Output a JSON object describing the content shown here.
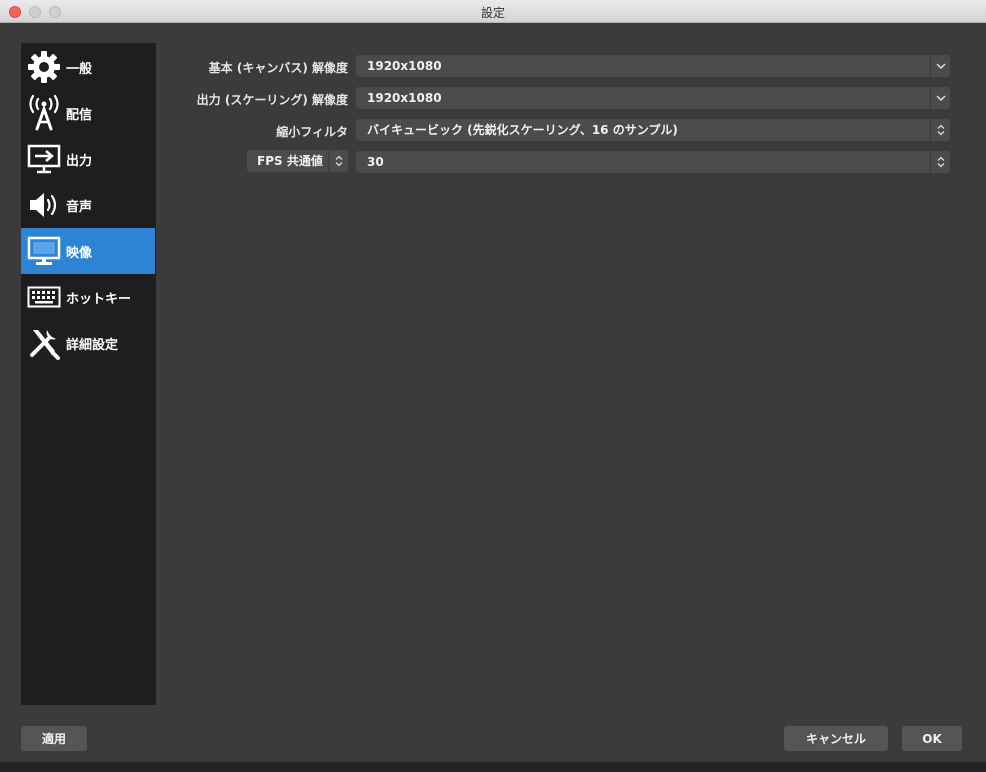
{
  "window": {
    "title": "設定"
  },
  "sidebar": {
    "items": [
      {
        "label": "一般",
        "icon": "gear-icon"
      },
      {
        "label": "配信",
        "icon": "broadcast-antenna-icon"
      },
      {
        "label": "出力",
        "icon": "output-monitor-icon"
      },
      {
        "label": "音声",
        "icon": "speaker-icon"
      },
      {
        "label": "映像",
        "icon": "monitor-icon",
        "active": true
      },
      {
        "label": "ホットキー",
        "icon": "keyboard-icon"
      },
      {
        "label": "詳細設定",
        "icon": "tools-icon"
      }
    ]
  },
  "video": {
    "base_resolution": {
      "label": "基本 (キャンバス) 解像度",
      "value": "1920x1080"
    },
    "output_resolution": {
      "label": "出力 (スケーリング) 解像度",
      "value": "1920x1080"
    },
    "downscale_filter": {
      "label": "縮小フィルタ",
      "value": "バイキュービック (先鋭化スケーリング、16 のサンプル)"
    },
    "fps": {
      "type_label": "FPS 共通値",
      "value": "30"
    }
  },
  "buttons": {
    "apply": "適用",
    "cancel": "キャンセル",
    "ok": "OK"
  },
  "colors": {
    "accent": "#2d83d4",
    "background": "#3b3b3b",
    "sidebar": "#1e1e1e"
  }
}
